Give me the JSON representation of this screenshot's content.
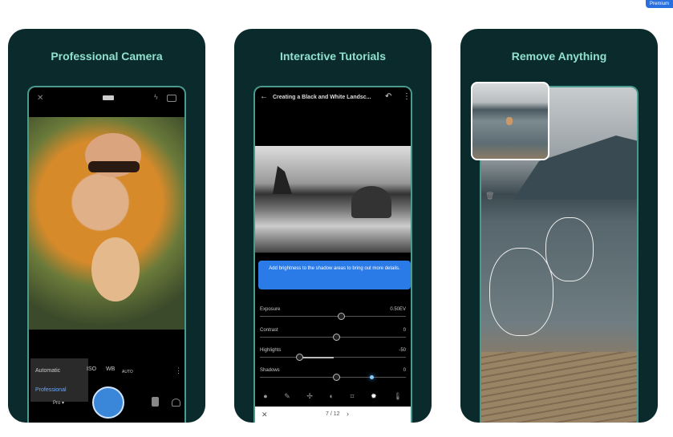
{
  "badge": "Premium",
  "cards": [
    {
      "title": "Professional Camera",
      "camera": {
        "modes": [
          "Automatic",
          "Professional"
        ],
        "mode_select": "Pro ▾",
        "controls": [
          "ISO",
          "WB",
          "AUTO"
        ]
      }
    },
    {
      "title": "Interactive Tutorials",
      "tutorial": {
        "header": "Creating a Black and White Landsc...",
        "tip": "Add brightness to the shadow areas to bring out more details.",
        "sliders": [
          {
            "label": "Exposure",
            "value": "0.50EV",
            "pos": 0.53
          },
          {
            "label": "Contrast",
            "value": "0",
            "pos": 0.5
          },
          {
            "label": "Highlights",
            "value": "-50",
            "pos": 0.25
          },
          {
            "label": "Shadows",
            "value": "0",
            "pos": 0.5
          }
        ],
        "pager": "7 / 12"
      }
    },
    {
      "title": "Remove Anything"
    }
  ],
  "colors": {
    "card": "#0b2a2b",
    "title": "#8fe0cf",
    "accent": "#2a6fe0"
  }
}
